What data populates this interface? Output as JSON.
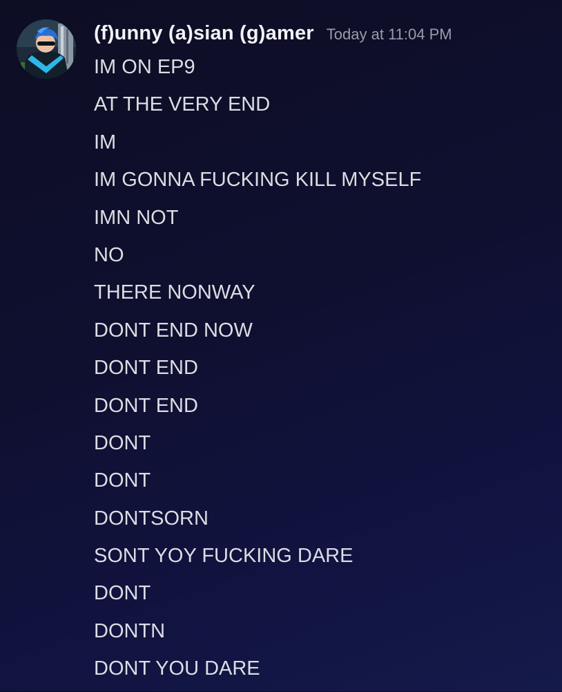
{
  "message": {
    "author": "(f)unny (a)sian (g)amer",
    "timestamp": "Today at 11:04 PM",
    "avatar_icon": "user-avatar-icon",
    "lines": [
      "IM ON EP9",
      "AT THE VERY END",
      "IM",
      "IM GONNA FUCKING KILL MYSELF",
      "IMN NOT",
      "NO",
      "THERE NONWAY",
      "DONT END NOW",
      "DONT END",
      "DONT END",
      "DONT",
      "DONT",
      "DONTSORN",
      "SONT YOY FUCKING DARE",
      "DONT",
      "DONTN",
      "DONT YOU DARE"
    ]
  },
  "colors": {
    "background": "#0f1030",
    "username": "#f2f3f5",
    "text": "#dcdde3",
    "timestamp": "#9a9ca8"
  }
}
